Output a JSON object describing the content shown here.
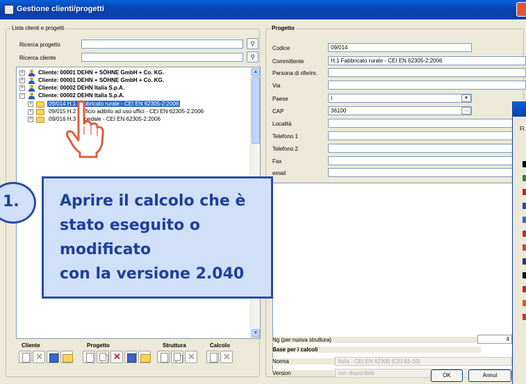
{
  "window": {
    "title": "Gestione clienti/progetti"
  },
  "left_panel": {
    "group_label": "Lista clienti e progetti",
    "search_project_label": "Ricerca progetto",
    "search_project_value": "",
    "search_client_label": "Ricerca cliente",
    "search_client_value": "",
    "tree": [
      {
        "label": "Cliente: 00001 DEHN + SÖHNE GmbH + Co. KG.",
        "type": "client",
        "expanded": false
      },
      {
        "label": "Cliente: 00001 DEHN + SÖHNE GmbH + Co. KG.",
        "type": "client",
        "expanded": false
      },
      {
        "label": "Cliente: 00002 DEHN Italia S.p.A.",
        "type": "client",
        "expanded": false
      },
      {
        "label": "Cliente: 00002 DEHN Italia S.p.A.",
        "type": "client",
        "expanded": true
      },
      {
        "label": "09/014 H.1 Fabbricato rurale - CEI EN 62305-2:2006",
        "type": "project",
        "selected": true
      },
      {
        "label": "09/015 H.2 Edificio adibito ad uso uffici - CEI EN 62305-2:2006",
        "type": "project",
        "selected": false
      },
      {
        "label": "09/016 H.3 Ospedale - CEI EN 62305-2:2006",
        "type": "project",
        "selected": false
      }
    ],
    "toolbar": {
      "cliente_label": "Cliente",
      "progetto_label": "Progetto",
      "struttura_label": "Struttura",
      "calcolo_label": "Calcolo"
    }
  },
  "right_panel": {
    "group_label": "Progetto",
    "fields": {
      "codice": {
        "label": "Codice",
        "value": "09/014"
      },
      "committente": {
        "label": "Committente",
        "value": "H.1  Fabbricato rurale - CEI EN 62305-2:2006"
      },
      "persona": {
        "label": "Persona di riferim.",
        "value": ""
      },
      "via": {
        "label": "Via",
        "value": ""
      },
      "paese": {
        "label": "Paese",
        "value": "I"
      },
      "cap": {
        "label": "CAP",
        "value": "36100"
      },
      "localita": {
        "label": "Località",
        "value": ""
      },
      "telefono1": {
        "label": "Telefono 1",
        "value": ""
      },
      "telefono2": {
        "label": "Telefono 2",
        "value": ""
      },
      "fax": {
        "label": "Fax",
        "value": ""
      },
      "email": {
        "label": "email",
        "value": ""
      }
    },
    "ng_label": "Ng (per nuova struttura)",
    "ng_value": "4",
    "base_label": "Base per i calcoli",
    "norma_label": "Norma",
    "norma_value": "Italia             - CEI EN 62305 (CEI 81-10)",
    "version_label": "Version",
    "version_value": "non disponibile",
    "ok_label": "OK",
    "cancel_label": "Annul"
  },
  "callout": {
    "number": "1.",
    "lines": [
      "Aprire il calcolo che è",
      "stato eseguito o modificato",
      "con la versione 2.040"
    ]
  },
  "side_window": {
    "menu_letter": "Fi"
  },
  "colors": {
    "title_blue": "#0a3fa8",
    "callout_bg": "#cfe0f8",
    "callout_text": "#1f3f9b",
    "selection": "#316ac5"
  }
}
